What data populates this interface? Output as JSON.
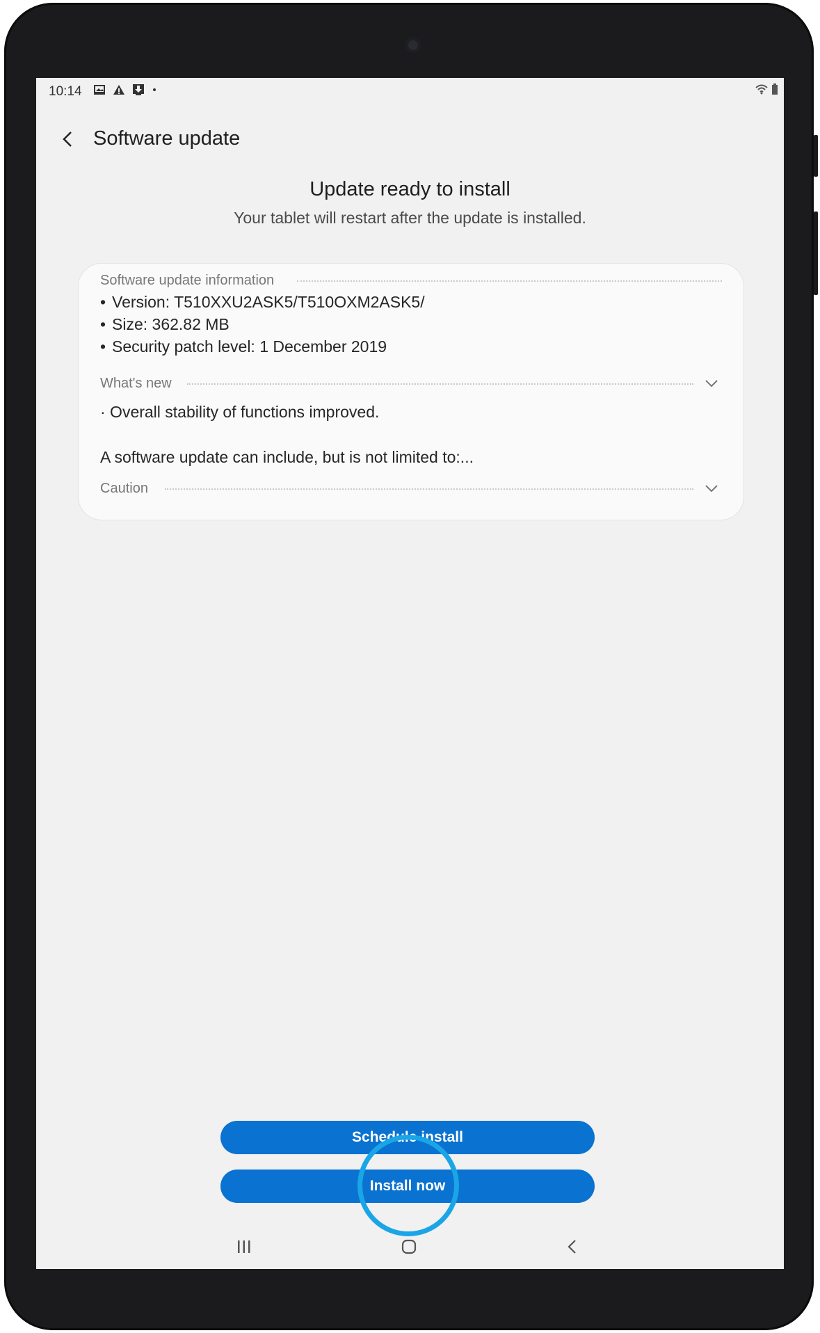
{
  "status_bar": {
    "time": "10:14",
    "left_icons": [
      "gallery-icon",
      "warning-icon",
      "download-icon",
      "dot-icon"
    ],
    "right_icons": [
      "wifi-icon",
      "battery-icon"
    ]
  },
  "app_bar": {
    "back_icon": "back-arrow-icon",
    "title": "Software update"
  },
  "header": {
    "title": "Update ready to install",
    "subtitle": "Your tablet will restart after the update is installed."
  },
  "card": {
    "info_section": {
      "heading": "Software update information",
      "items": [
        "Version: T510XXU2ASK5/T510OXM2ASK5/",
        "Size: 362.82 MB",
        "Security patch level: 1 December 2019"
      ]
    },
    "whats_new": {
      "heading": "What's new",
      "text": "· Overall stability of functions improved.",
      "summary": "A software update can include, but is not limited to:..."
    },
    "caution": {
      "heading": "Caution"
    }
  },
  "buttons": {
    "schedule": "Schedule install",
    "install_now": "Install now"
  },
  "nav_bar": {
    "items": [
      "recents-icon",
      "home-icon",
      "back-icon"
    ]
  },
  "colors": {
    "accent": "#0a72d1",
    "touch_indicator": "#1aa6e6",
    "screen_bg": "#f1f1f1",
    "device_frame": "#1b1b1d"
  }
}
